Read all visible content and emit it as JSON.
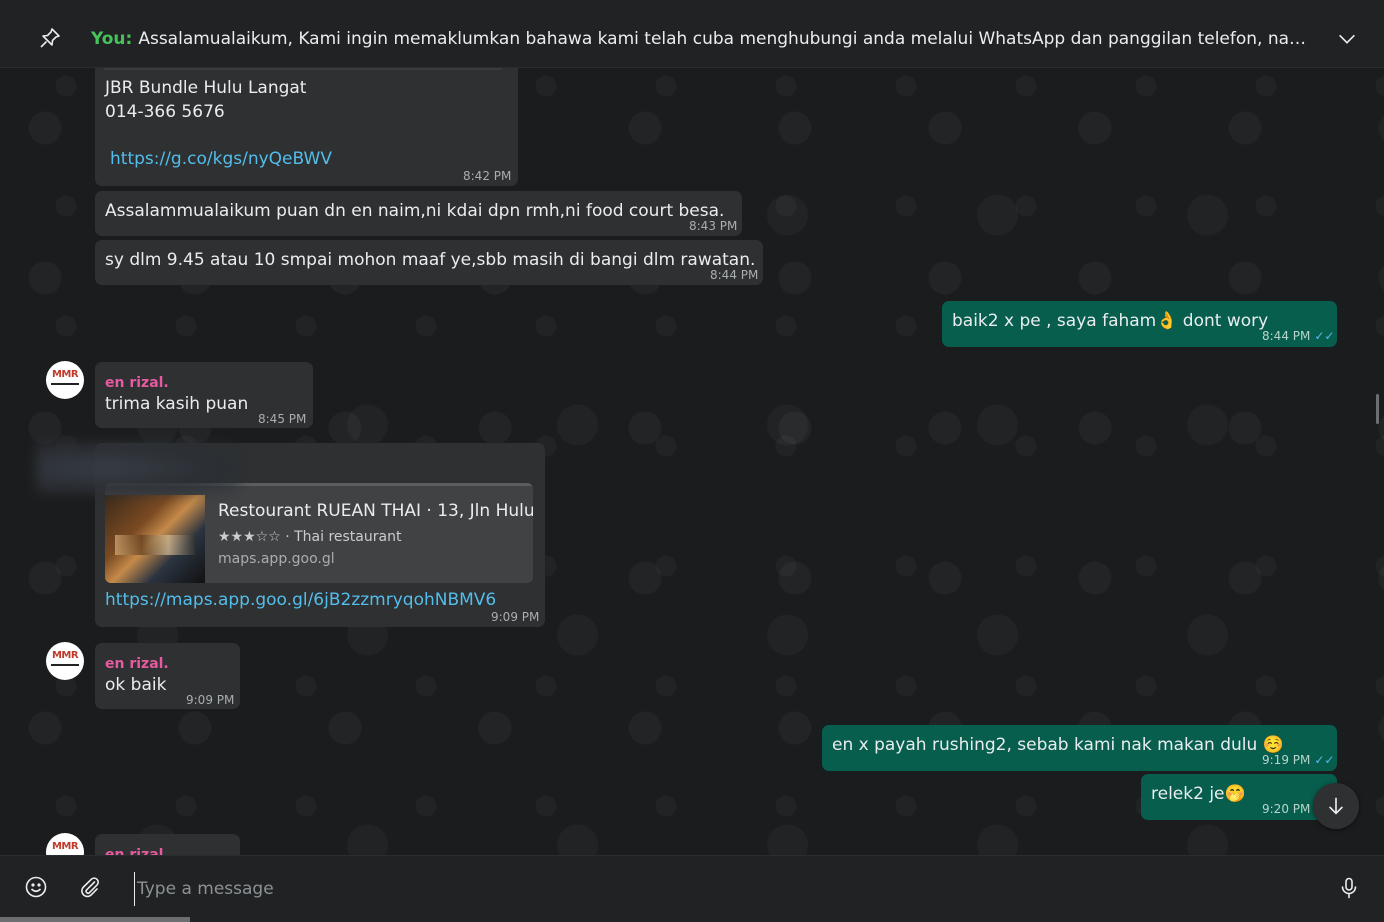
{
  "pinned": {
    "sender": "You:",
    "text": "Assalamualaikum,  Kami ingin memaklumkan bahawa kami telah cuba menghubungi anda melalui WhatsApp dan panggilan telefon, namun tidak mener…"
  },
  "messages": {
    "m1": {
      "line1": "JBR Bundle Hulu Langat",
      "line2": "014-366 5676",
      "link": "https://g.co/kgs/nyQeBWV",
      "time": "8:42 PM"
    },
    "m2": {
      "text": "Assalammualaikum puan dn en naim,ni kdai dpn rmh,ni food court besa.",
      "time": "8:43 PM"
    },
    "m3": {
      "text": "sy dlm 9.45 atau 10 smpai mohon maaf ye,sbb masih di bangi dlm rawatan.",
      "time": "8:44 PM"
    },
    "m4": {
      "text": "baik2 x pe , saya faham👌 dont wory",
      "time": "8:44 PM"
    },
    "m5": {
      "sender": "en rizal.",
      "text": "trima kasih puan",
      "time": "8:45 PM"
    },
    "m6": {
      "card_title": "Restourant RUEAN THAI · 13, Jln Hulu…",
      "card_subtitle": "★★★☆☆ · Thai restaurant",
      "card_domain": "maps.app.goo.gl",
      "link": "https://maps.app.goo.gl/6jB2zzmryqohNBMV6",
      "time": "9:09 PM"
    },
    "m7": {
      "sender": "en rizal.",
      "text": "ok baik",
      "time": "9:09 PM"
    },
    "m8": {
      "text": "en x payah rushing2, sebab kami nak makan dulu ☺️",
      "time": "9:19 PM"
    },
    "m9": {
      "text": "relek2 je🤭",
      "time": "9:20 PM"
    },
    "m10": {
      "sender": "en rizal."
    }
  },
  "avatar_text": "MMR",
  "ticks": "✓✓",
  "composer": {
    "placeholder": "Type a message"
  },
  "colors": {
    "outgoing": "#075e4d",
    "incoming": "#2e3031",
    "sender": "#e55aa0",
    "link": "#53bdeb",
    "you": "#46c35b"
  }
}
